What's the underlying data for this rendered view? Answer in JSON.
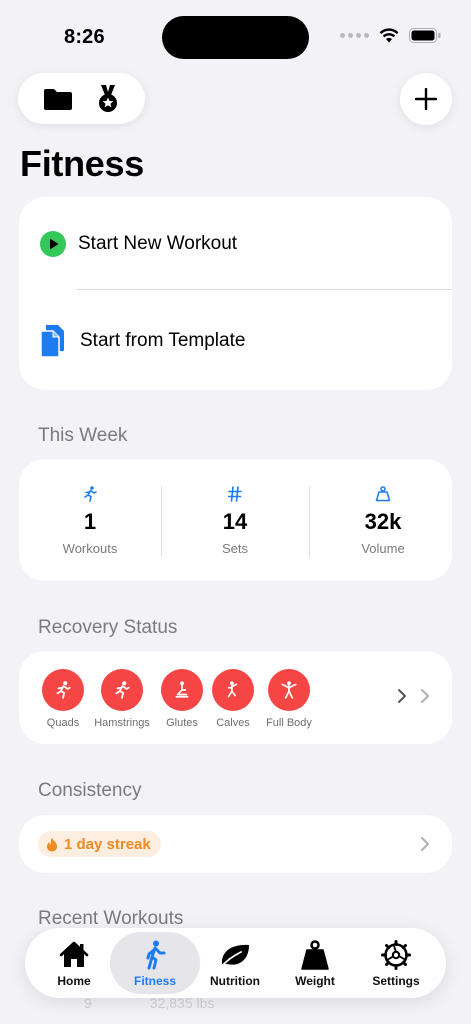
{
  "status_bar": {
    "time": "8:26"
  },
  "page": {
    "title": "Fitness"
  },
  "actions": {
    "start_new_workout": "Start New Workout",
    "start_from_template": "Start from Template"
  },
  "this_week": {
    "section_label": "This Week",
    "stats": [
      {
        "icon": "running-figure-icon",
        "value": "1",
        "label": "Workouts"
      },
      {
        "icon": "number-sign-icon",
        "value": "14",
        "label": "Sets"
      },
      {
        "icon": "weight-icon",
        "value": "32k",
        "label": "Volume"
      }
    ]
  },
  "recovery": {
    "section_label": "Recovery Status",
    "muscles": [
      {
        "label": "Quads"
      },
      {
        "label": "Hamstrings"
      },
      {
        "label": "Glutes"
      },
      {
        "label": "Calves"
      },
      {
        "label": "Full Body"
      }
    ]
  },
  "consistency": {
    "section_label": "Consistency",
    "streak": "1 day streak"
  },
  "recent": {
    "section_label": "Recent Workouts",
    "partial_sets": "9",
    "partial_volume": "32,835 lbs"
  },
  "tabs": [
    {
      "label": "Home",
      "icon": "house-icon",
      "active": false
    },
    {
      "label": "Fitness",
      "icon": "walking-figure-icon",
      "active": true
    },
    {
      "label": "Nutrition",
      "icon": "leaf-icon",
      "active": false
    },
    {
      "label": "Weight",
      "icon": "scale-weight-icon",
      "active": false
    },
    {
      "label": "Settings",
      "icon": "gear-icon",
      "active": false
    }
  ],
  "colors": {
    "accent": "#1e7cf2",
    "recovery_red": "#f64545",
    "play_green": "#34c759",
    "streak_orange": "#f08a24"
  }
}
